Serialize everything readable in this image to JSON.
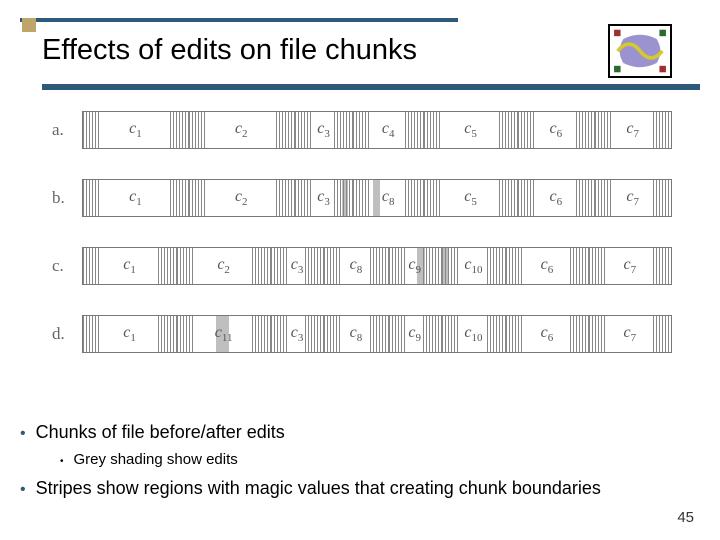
{
  "title": "Effects of edits on file chunks",
  "slide_number": "45",
  "bullets": {
    "b1": "Chunks of file before/after edits",
    "b1_sub": "Grey shading show edits",
    "b2": "Stripes show regions with magic values that creating chunk boundaries"
  },
  "rows": [
    {
      "label": "a.",
      "chunks": [
        {
          "name": "c1",
          "sub": "1",
          "w": 18,
          "sl": true,
          "sr": true
        },
        {
          "name": "c2",
          "sub": "2",
          "w": 18,
          "sl": true,
          "sr": true
        },
        {
          "name": "c3",
          "sub": "3",
          "w": 10,
          "sl": true,
          "sr": true
        },
        {
          "name": "c4",
          "sub": "4",
          "w": 12,
          "sl": true,
          "sr": true
        },
        {
          "name": "c5",
          "sub": "5",
          "w": 16,
          "sl": true,
          "sr": true
        },
        {
          "name": "c6",
          "sub": "6",
          "w": 13,
          "sl": true,
          "sr": true
        },
        {
          "name": "c7",
          "sub": "7",
          "w": 13,
          "sl": true,
          "sr": true
        }
      ]
    },
    {
      "label": "b.",
      "chunks": [
        {
          "name": "c1",
          "sub": "1",
          "w": 18,
          "sl": true,
          "sr": true
        },
        {
          "name": "c2",
          "sub": "2",
          "w": 18,
          "sl": true,
          "sr": true
        },
        {
          "name": "c3",
          "sub": "3",
          "w": 10,
          "sl": true,
          "sr": true,
          "grey": {
            "l": 82,
            "w": 10
          }
        },
        {
          "name": "c8",
          "sub": "8",
          "w": 12,
          "sl": true,
          "sr": true,
          "grey": {
            "l": 28,
            "w": 10
          }
        },
        {
          "name": "c5",
          "sub": "5",
          "w": 16,
          "sl": true,
          "sr": true
        },
        {
          "name": "c6",
          "sub": "6",
          "w": 13,
          "sl": true,
          "sr": true
        },
        {
          "name": "c7",
          "sub": "7",
          "w": 13,
          "sl": true,
          "sr": true
        }
      ]
    },
    {
      "label": "c.",
      "chunks": [
        {
          "name": "c1",
          "sub": "1",
          "w": 16,
          "sl": true,
          "sr": true
        },
        {
          "name": "c2",
          "sub": "2",
          "w": 16,
          "sl": true,
          "sr": true
        },
        {
          "name": "c3",
          "sub": "3",
          "w": 9,
          "sl": true,
          "sr": true
        },
        {
          "name": "c8",
          "sub": "8",
          "w": 11,
          "sl": true,
          "sr": true
        },
        {
          "name": "c9",
          "sub": "9",
          "w": 9,
          "sl": true,
          "sr": true,
          "grey": {
            "l": 55,
            "w": 14
          }
        },
        {
          "name": "c10",
          "sub": "10",
          "w": 11,
          "sl": true,
          "sr": true,
          "grey": {
            "l": 0,
            "w": 10
          }
        },
        {
          "name": "c6",
          "sub": "6",
          "w": 14,
          "sl": true,
          "sr": true
        },
        {
          "name": "c7",
          "sub": "7",
          "w": 14,
          "sl": true,
          "sr": true
        }
      ]
    },
    {
      "label": "d.",
      "chunks": [
        {
          "name": "c1",
          "sub": "1",
          "w": 16,
          "sl": true,
          "sr": true
        },
        {
          "name": "c11",
          "sub": "11",
          "w": 16,
          "sl": true,
          "sr": true,
          "grey": {
            "l": 42,
            "w": 14
          }
        },
        {
          "name": "c3",
          "sub": "3",
          "w": 9,
          "sl": true,
          "sr": true
        },
        {
          "name": "c8",
          "sub": "8",
          "w": 11,
          "sl": true,
          "sr": true
        },
        {
          "name": "c9",
          "sub": "9",
          "w": 9,
          "sl": true,
          "sr": true
        },
        {
          "name": "c10",
          "sub": "10",
          "w": 11,
          "sl": true,
          "sr": true
        },
        {
          "name": "c6",
          "sub": "6",
          "w": 14,
          "sl": true,
          "sr": true
        },
        {
          "name": "c7",
          "sub": "7",
          "w": 14,
          "sl": true,
          "sr": true
        }
      ]
    }
  ]
}
